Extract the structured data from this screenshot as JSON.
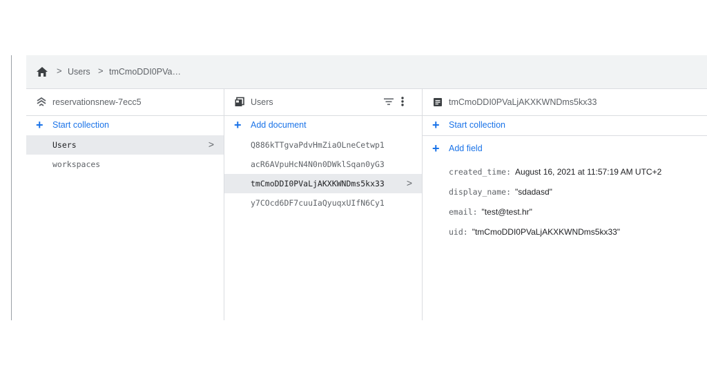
{
  "breadcrumb": {
    "home_icon": "home-icon",
    "items": [
      "Users",
      "tmCmoDDI0PVa…"
    ]
  },
  "columns": {
    "project": {
      "title": "reservationsnew-7ecc5",
      "icon": "firestore-icon",
      "action": "Start collection",
      "items": [
        {
          "label": "Users",
          "selected": true
        },
        {
          "label": "workspaces",
          "selected": false
        }
      ]
    },
    "collection": {
      "title": "Users",
      "icon": "collection-icon",
      "action": "Add document",
      "items": [
        {
          "label": "Q886kTTgvaPdvHmZiaOLneCetwp1",
          "selected": false
        },
        {
          "label": "acR6AVpuHcN4N0n0DWklSqan0yG3",
          "selected": false
        },
        {
          "label": "tmCmoDDI0PVaLjAKXKWNDms5kx33",
          "selected": true
        },
        {
          "label": "y7COcd6DF7cuuIaQyuqxUIfN6Cy1",
          "selected": false
        }
      ]
    },
    "document": {
      "title": "tmCmoDDI0PVaLjAKXKWNDms5kx33",
      "icon": "document-icon",
      "action": "Start collection",
      "add_field": "Add field",
      "fields": [
        {
          "key": "created_time:",
          "value": "August 16, 2021 at 11:57:19 AM UTC+2"
        },
        {
          "key": "display_name:",
          "value": "\"sdadasd\""
        },
        {
          "key": "email:",
          "value": "\"test@test.hr\""
        },
        {
          "key": "uid:",
          "value": "\"tmCmoDDI0PVaLjAKXKWNDms5kx33\""
        }
      ]
    }
  },
  "colors": {
    "accent": "#1a73e8",
    "selected_bg": "#e8eaed",
    "header_bg": "#f1f3f4"
  }
}
